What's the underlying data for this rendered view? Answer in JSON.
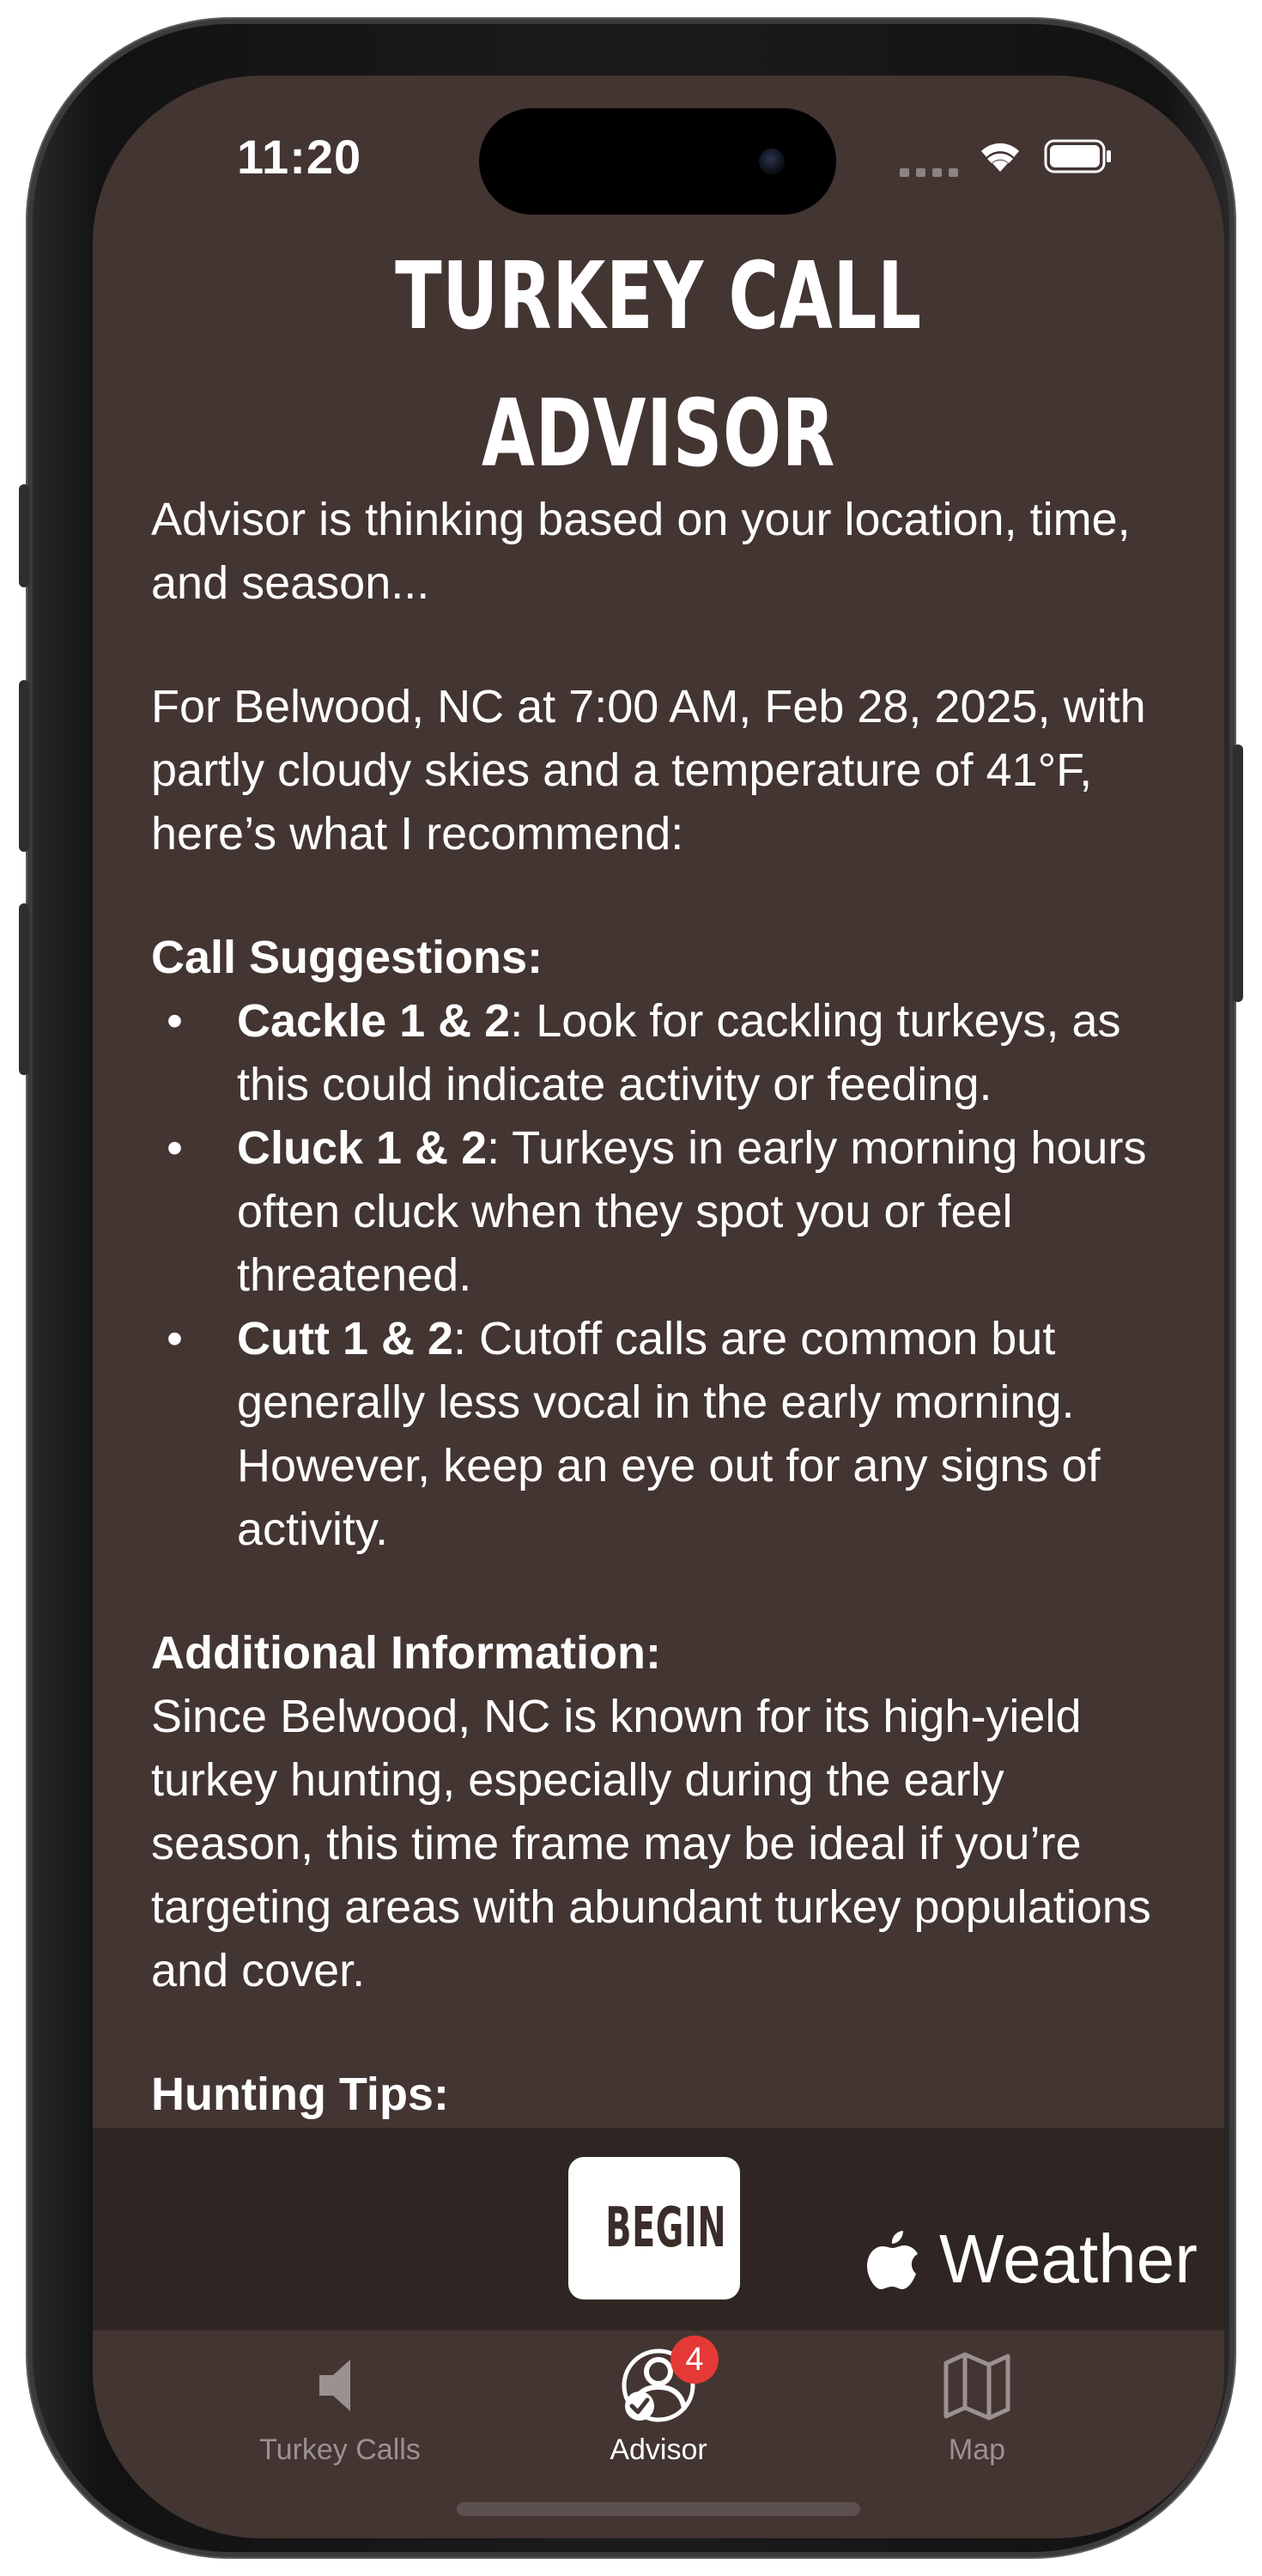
{
  "status_bar": {
    "time": "11:20"
  },
  "header": {
    "title": "TURKEY CALL ADVISOR"
  },
  "advisor": {
    "thinking": "Advisor is thinking based on your location, time, and season...",
    "intro": "For Belwood, NC at 7:00 AM, Feb 28, 2025, with partly cloudy skies and a temperature of 41°F, here’s what I recommend:",
    "calls_heading": "Call Suggestions:",
    "calls": [
      {
        "bullet": "•",
        "name": "Cackle 1 & 2",
        "text": ": Look for cackling turkeys, as this could indicate activity or feeding."
      },
      {
        "bullet": "•",
        "name": "Cluck 1 & 2",
        "text": ": Turkeys in early morning hours often cluck when they spot you or feel threatened."
      },
      {
        "bullet": "•",
        "name": "Cutt 1 & 2",
        "text": ": Cutoff calls are common but generally less vocal in the early morning. However, keep an eye out for any signs of activity."
      }
    ],
    "additional_heading": "Additional Information:",
    "additional_text": "Since Belwood, NC is known for its high-yield turkey hunting, especially during the early season, this time frame may be ideal if you’re targeting areas with abundant turkey populations and cover.",
    "tips_heading": "Hunting Tips:"
  },
  "actions": {
    "begin_label": "BEGIN",
    "weather_attribution": "Weather",
    "weather_icon": "apple-logo-icon"
  },
  "tabbar": {
    "tabs": [
      {
        "label": "Turkey Calls",
        "icon": "speaker-icon",
        "active": false
      },
      {
        "label": "Advisor",
        "icon": "advisor-icon",
        "active": true,
        "badge": "4"
      },
      {
        "label": "Map",
        "icon": "map-icon",
        "active": false
      }
    ]
  },
  "colors": {
    "background": "#433532",
    "action_bar": "#2f2624",
    "tab_inactive": "#9b9190",
    "badge": "#e53935"
  }
}
